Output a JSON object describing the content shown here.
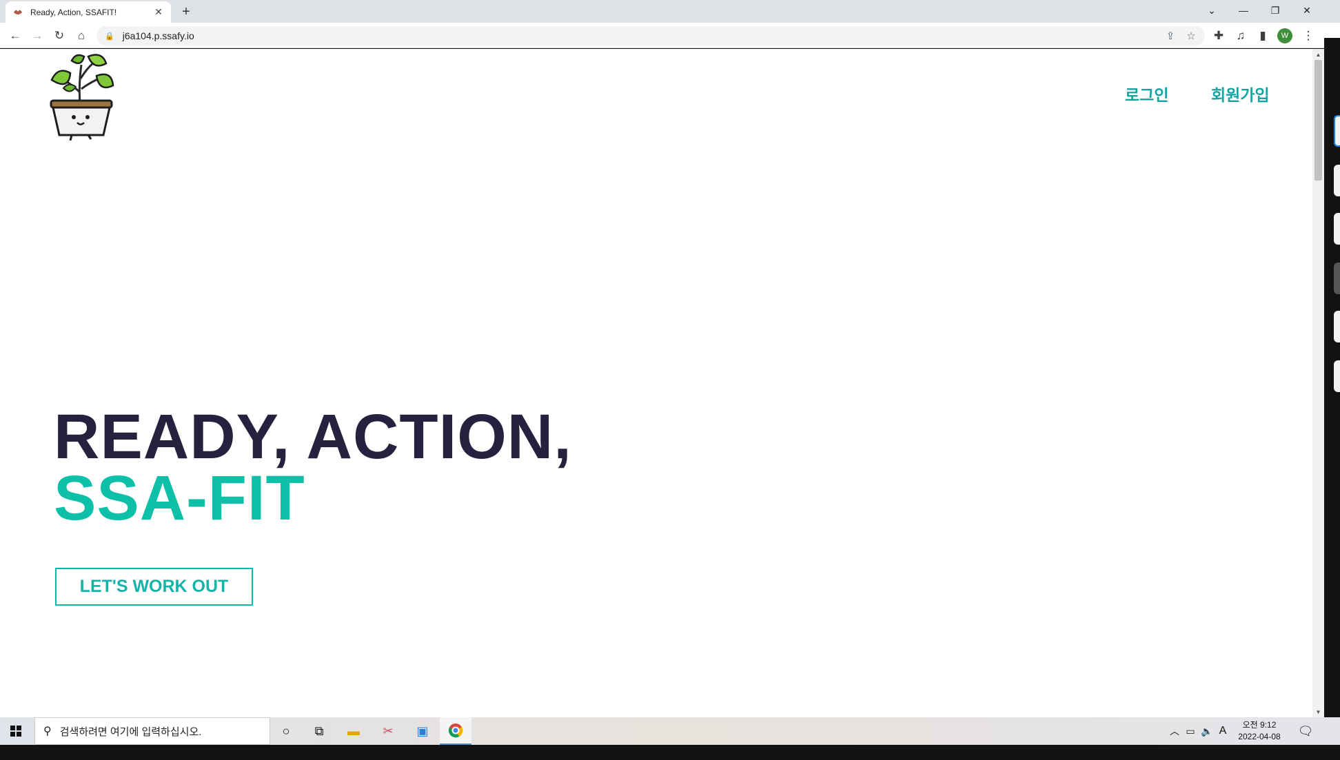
{
  "browser": {
    "tab_title": "Ready, Action, SSAFIT!",
    "url": "j6a104.p.ssafy.io",
    "profile_initial": "W"
  },
  "header": {
    "login": "로그인",
    "signup": "회원가입"
  },
  "hero": {
    "line1": "READY, ACTION,",
    "line2": "SSA-FIT",
    "cta": "LET'S WORK OUT"
  },
  "taskbar": {
    "search_placeholder": "검색하려면 여기에 입력하십시오.",
    "ime": "A",
    "time": "오전 9:12",
    "date": "2022-04-08"
  },
  "colors": {
    "accent": "#14a4a4",
    "hero_dark": "#25223f",
    "hero_teal": "#0fc0a8"
  }
}
